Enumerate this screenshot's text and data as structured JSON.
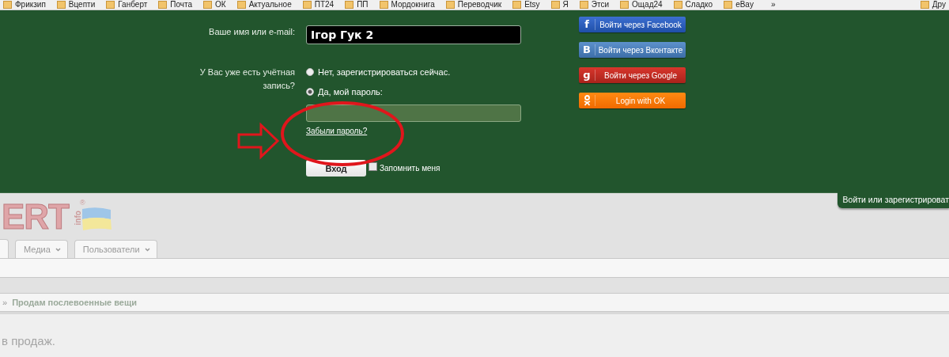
{
  "bookmarks": [
    {
      "label": "Фрикзип"
    },
    {
      "label": "Вцепти"
    },
    {
      "label": "Ганберт"
    },
    {
      "label": "Почта"
    },
    {
      "label": "ОК"
    },
    {
      "label": "Актуальное"
    },
    {
      "label": "ПТ24"
    },
    {
      "label": "ПП"
    },
    {
      "label": "Мордокнига"
    },
    {
      "label": "Переводчик"
    },
    {
      "label": "Etsy"
    },
    {
      "label": "Я"
    },
    {
      "label": "Этси"
    },
    {
      "label": "Ощад24"
    },
    {
      "label": "Сладко"
    },
    {
      "label": "eBay"
    }
  ],
  "bookmarks_more": "»",
  "bookmarks_folder": "Дру",
  "login": {
    "username": {
      "label": "Ваше имя или e-mail:",
      "value": "Ігор Гук 2"
    },
    "account_question": "У Вас уже есть учётная запись?",
    "options": [
      {
        "label": "Нет, зарегистрироваться сейчас.",
        "selected": false
      },
      {
        "label": "Да, мой пароль:",
        "selected": true
      }
    ],
    "forgot_link": "Забыли пароль?",
    "submit": "Вход",
    "remember": {
      "label": "Запомнить меня",
      "checked": false
    }
  },
  "social_buttons": [
    {
      "kind": "facebook",
      "icon": "f",
      "label": "Войти через Facebook"
    },
    {
      "kind": "vkontakte",
      "icon": "B",
      "label": "Войти через Вконтакте"
    },
    {
      "kind": "google",
      "icon": "g",
      "label": "Войти через Google"
    },
    {
      "kind": "ok",
      "label": "Login with OK"
    }
  ],
  "login_tab": "Войти или зарегистрироват",
  "logo": {
    "text": "ERT",
    "small": "info",
    "mark": "®"
  },
  "nav_tabs": [
    {
      "label": "Медиа"
    },
    {
      "label": "Пользователи"
    }
  ],
  "breadcrumb": {
    "separator": "»",
    "current": "Продам послевоенные вещи"
  },
  "content_text": "в продаж."
}
